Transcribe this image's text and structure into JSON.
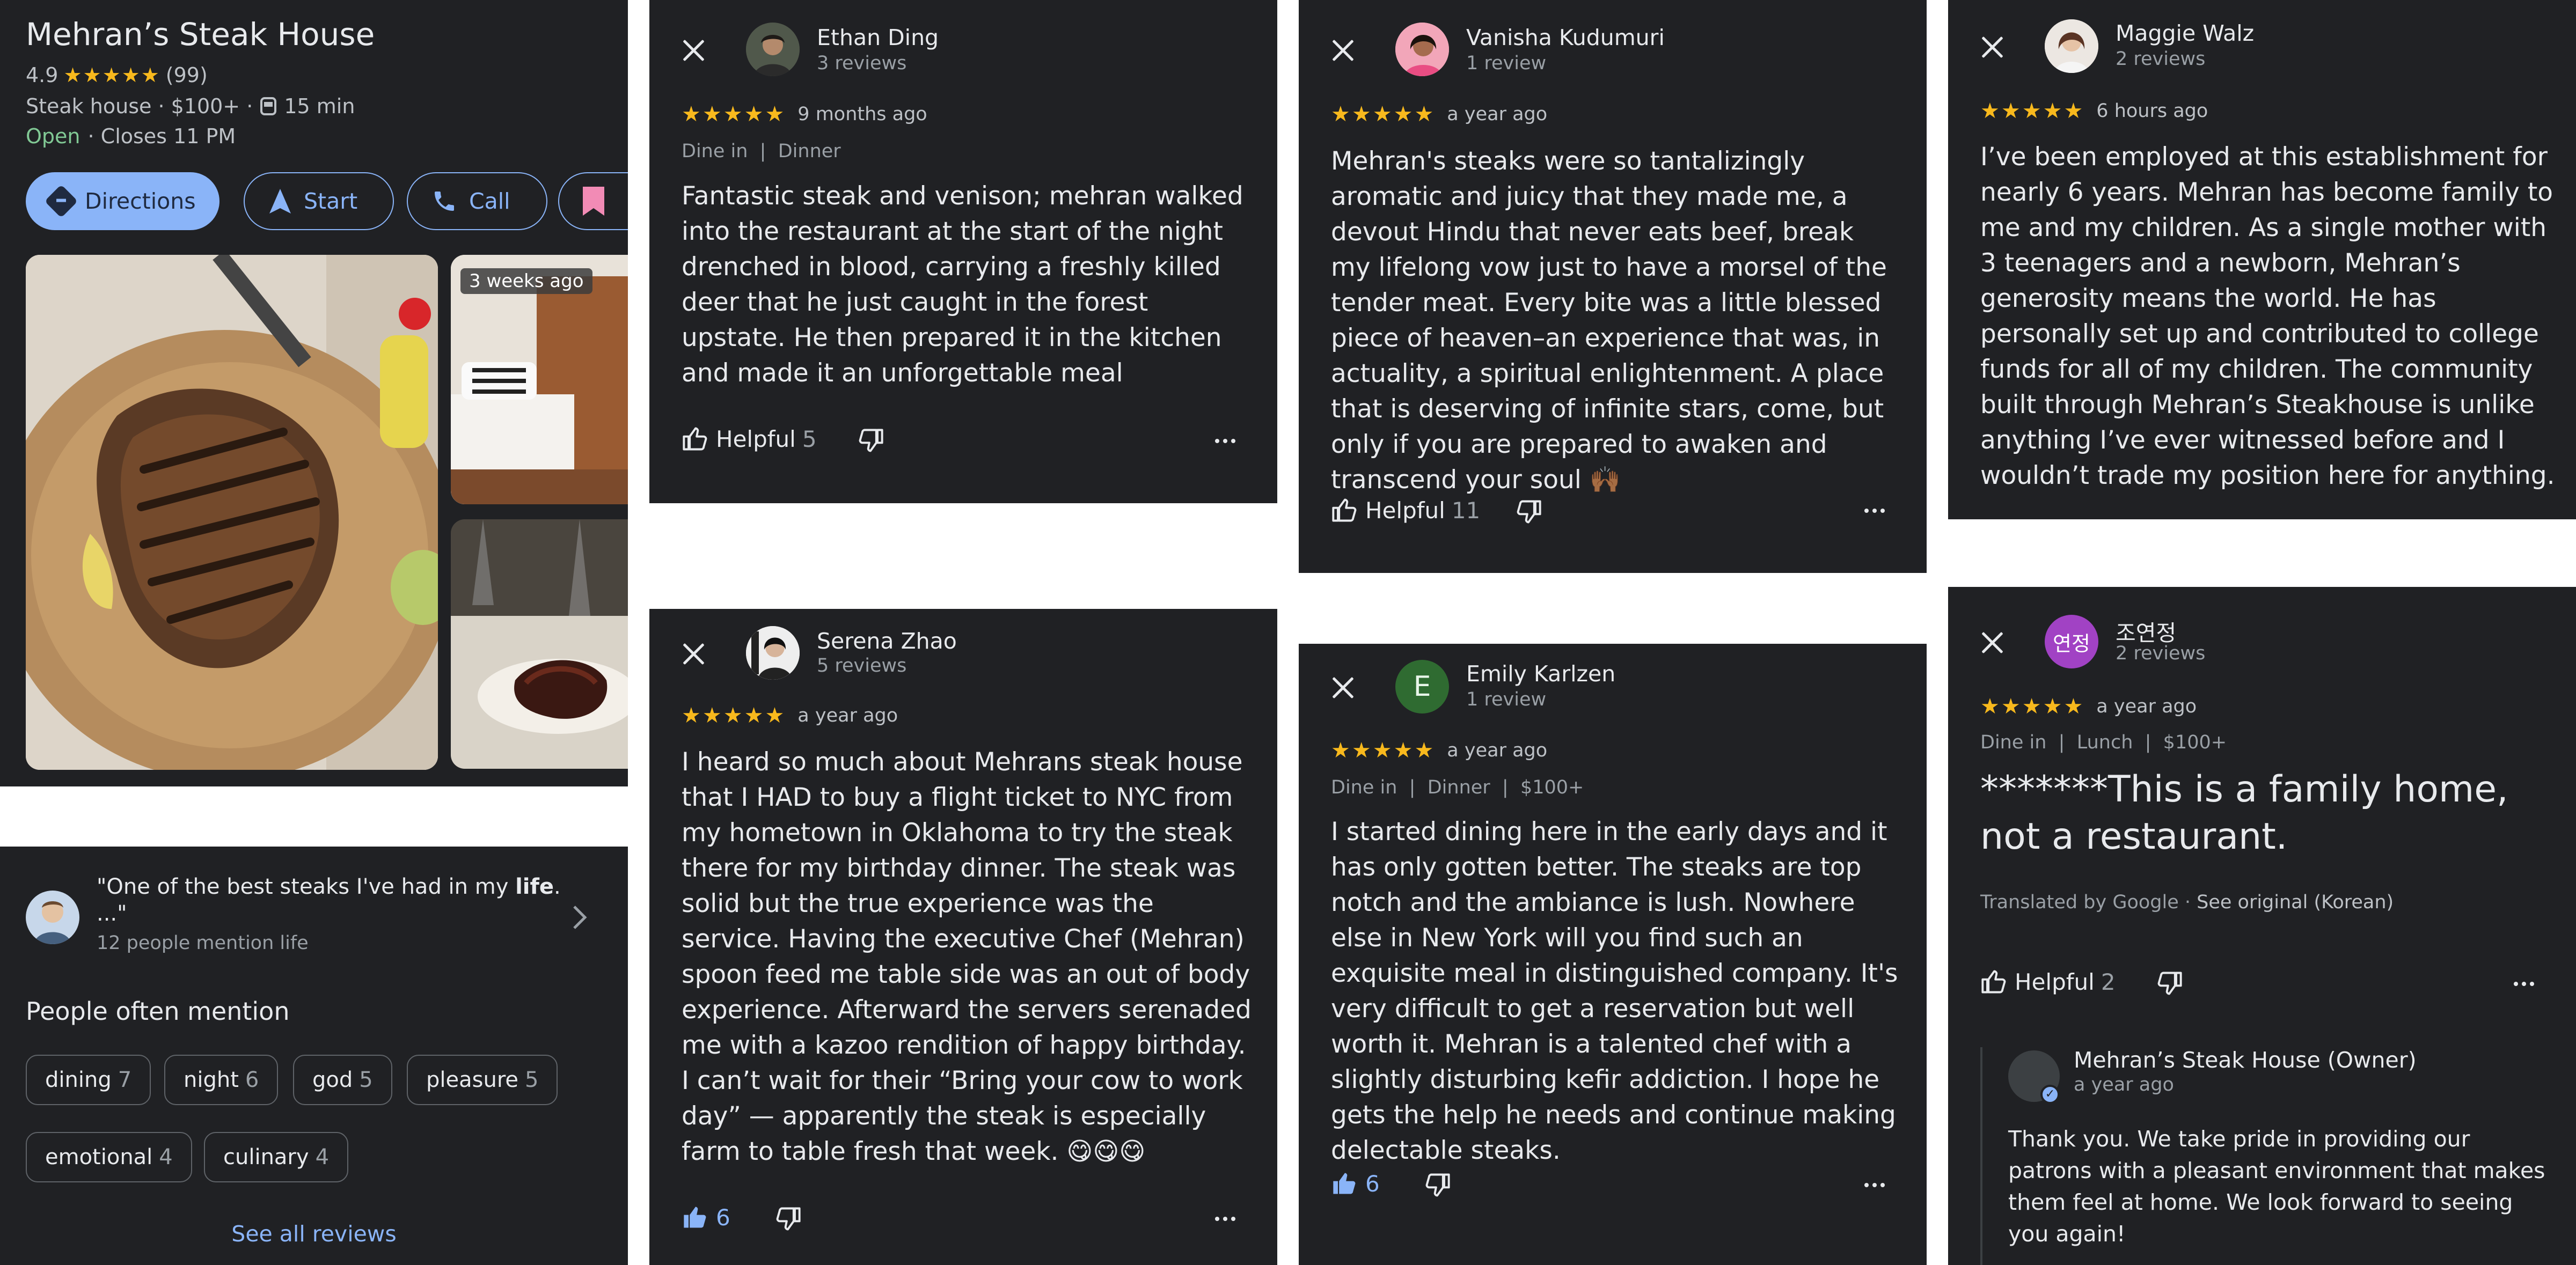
{
  "place": {
    "name": "Mehran’s Steak House",
    "rating": "4.9",
    "stars": "★★★★★",
    "review_count": "(99)",
    "category": "Steak house · $100+ ·",
    "transit_time": "15 min",
    "open_status": "Open",
    "closes": "· Closes 11 PM",
    "buttons": {
      "directions": "Directions",
      "start": "Start",
      "call": "Call"
    },
    "photo_badge": "3 weeks ago"
  },
  "highlight": {
    "quote_prefix": "\"One of the best steaks I've had in my ",
    "quote_bold": "life",
    "quote_suffix": ".",
    "quote_line2": "...\"",
    "mentions": "12 people mention life",
    "section_title": "People often mention",
    "chips": [
      {
        "label": "dining",
        "count": "7"
      },
      {
        "label": "night",
        "count": "6"
      },
      {
        "label": "god",
        "count": "5"
      },
      {
        "label": "pleasure",
        "count": "5"
      },
      {
        "label": "emotional",
        "count": "4"
      },
      {
        "label": "culinary",
        "count": "4"
      }
    ],
    "see_all": "See all reviews"
  },
  "reviews": {
    "ethan": {
      "name": "Ethan Ding",
      "count": "3 reviews",
      "stars": "★★★★★",
      "time": "9 months ago",
      "meta": "Dine in  |  Dinner",
      "text": "Fantastic steak and venison; mehran walked into the restaurant at the start of the night drenched in blood, carrying a freshly killed deer that he just caught in the forest upstate. He then prepared it in the kitchen and made it an unforgettable meal",
      "helpful_label": "Helpful",
      "helpful_count": "5"
    },
    "serena": {
      "name": "Serena Zhao",
      "count": "5 reviews",
      "stars": "★★★★★",
      "time": "a year ago",
      "text": "I heard so much about Mehrans steak house that I HAD to buy a flight ticket to NYC from my hometown in Oklahoma to try the steak there for my birthday dinner. The steak was solid but the true experience was the service. Having the executive Chef (Mehran) spoon feed me table side was an out of body experience. Afterward the servers serenaded me with a kazoo rendition of happy birthday. I can’t wait for their “Bring your cow to work day” — apparently the steak is especially farm to table fresh that week. 😋😋😋",
      "likes": "6"
    },
    "vanisha": {
      "name": "Vanisha Kudumuri",
      "count": "1 review",
      "stars": "★★★★★",
      "time": "a year ago",
      "text": "Mehran's steaks were so tantalizingly aromatic and juicy that they made me,  a devout Hindu that never eats beef, break my lifelong vow just to have a morsel of the tender meat. Every bite was a little blessed piece of heaven–an experience that was, in actuality, a spiritual enlightenment. A place that is deserving of infinite stars, come, but only if you are prepared to awaken and transcend your soul 🙌🏾",
      "helpful_label": "Helpful",
      "helpful_count": "11"
    },
    "emily": {
      "name": "Emily Karlzen",
      "count": "1 review",
      "initial": "E",
      "stars": "★★★★★",
      "time": "a year ago",
      "meta": "Dine in  |  Dinner  |  $100+",
      "text": "I started dining here in the early days and it has only gotten better. The steaks are top notch and the ambiance is lush. Nowhere else in New York will you find such an exquisite meal in distinguished company. It's very difficult to get a reservation but well worth it. Mehran is a talented chef with a slightly disturbing kefir addiction. I hope he gets the help he needs and continue making delectable steaks.",
      "likes": "6"
    },
    "maggie": {
      "name": "Maggie Walz",
      "count": "2 reviews",
      "stars": "★★★★★",
      "time": "6 hours ago",
      "text": "I’ve been employed at this establishment for nearly 6 years. Mehran has become family to me and my children. As a single mother with 3 teenagers and a newborn, Mehran’s generosity means the world. He has personally set up and contributed to college funds for all of my children. The community built through Mehran’s Steakhouse is unlike anything I’ve ever witnessed before and I wouldn’t trade my position here for anything."
    },
    "korean": {
      "name": "조연정",
      "avatar_text": "연정",
      "count": "2 reviews",
      "stars": "★★★★★",
      "time": "a year ago",
      "meta": "Dine in  |  Lunch  |  $100+",
      "headline": "*******This is a family home, not a restaurant.",
      "translated": "Translated by Google · ",
      "see_original": "See original (Korean)",
      "helpful_label": "Helpful",
      "helpful_count": "2",
      "owner_name": "Mehran’s Steak House (Owner)",
      "owner_time": "a year ago",
      "owner_reply": "Thank you. We take pride in providing our patrons with a pleasant environment that makes them feel at home. We look forward to seeing you again!"
    }
  },
  "colors": {
    "bg": "#202124",
    "accent": "#8ab4f8",
    "star": "#f8b91d",
    "open": "#81c995"
  }
}
